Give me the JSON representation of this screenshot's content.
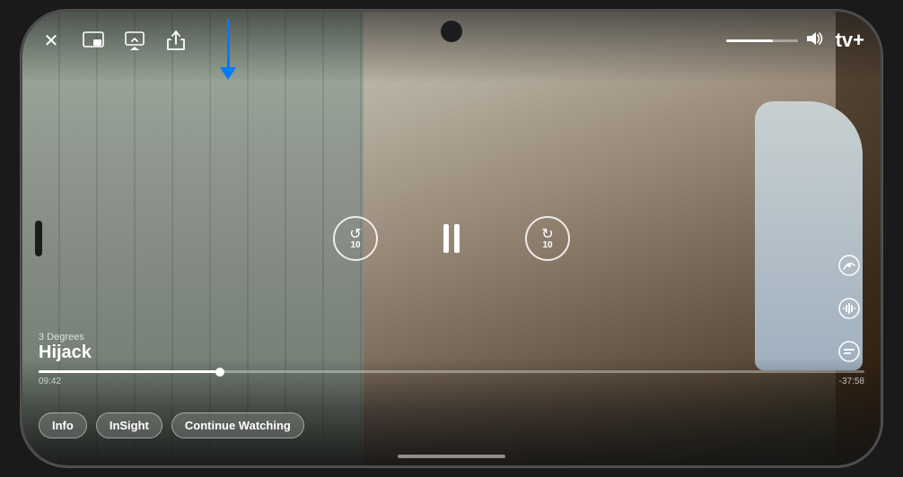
{
  "phone": {
    "notch": true
  },
  "header": {
    "close_label": "✕",
    "appletv_logo": "tv+",
    "appletv_apple": ""
  },
  "show": {
    "subtitle": "3 Degrees",
    "title": "Hijack"
  },
  "playback": {
    "rewind_seconds": "10",
    "forward_seconds": "10",
    "time_current": "09:42",
    "time_remaining": "-37:58",
    "volume_percent": 65,
    "progress_percent": 22
  },
  "bottom_buttons": {
    "info": "Info",
    "insight": "InSight",
    "continue_watching": "Continue Watching"
  },
  "arrow": {
    "color": "#007AFF"
  }
}
